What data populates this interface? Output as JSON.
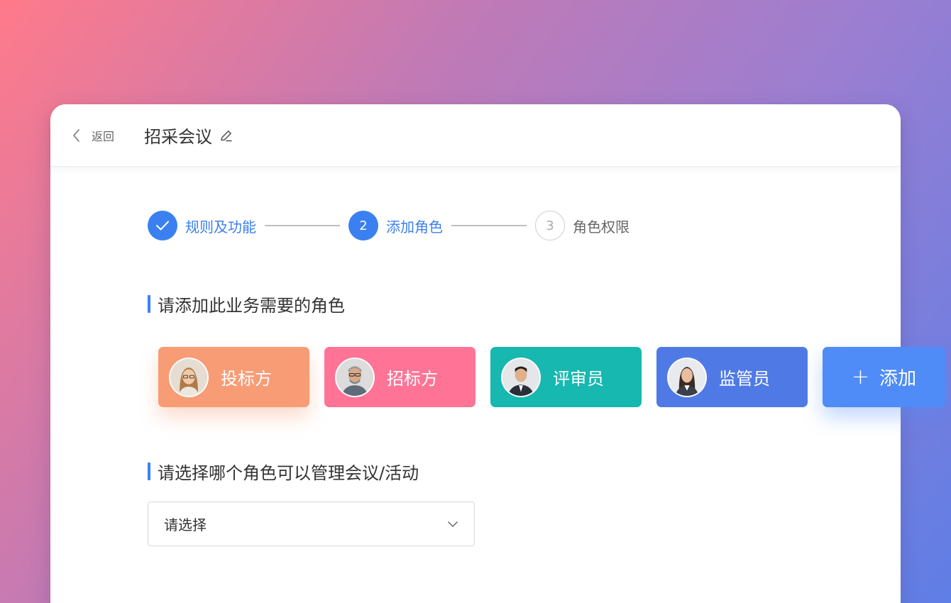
{
  "header": {
    "back_label": "返回",
    "title": "招采会议"
  },
  "steps": [
    {
      "number": "✓",
      "label": "规则及功能",
      "state": "done"
    },
    {
      "number": "2",
      "label": "添加角色",
      "state": "active"
    },
    {
      "number": "3",
      "label": "角色权限",
      "state": "pending"
    }
  ],
  "sections": {
    "add_roles_title": "请添加此业务需要的角色",
    "manager_title": "请选择哪个角色可以管理会议/活动"
  },
  "roles": [
    {
      "name": "投标方",
      "color": "#f89c76"
    },
    {
      "name": "招标方",
      "color": "#ff7496"
    },
    {
      "name": "评审员",
      "color": "#16b8b0"
    },
    {
      "name": "监管员",
      "color": "#4f7ae6"
    }
  ],
  "add_button": {
    "plus": "+",
    "label": "添加",
    "color": "#4f8cf7"
  },
  "select": {
    "placeholder": "请选择"
  },
  "colors": {
    "accent": "#3b80f0"
  }
}
